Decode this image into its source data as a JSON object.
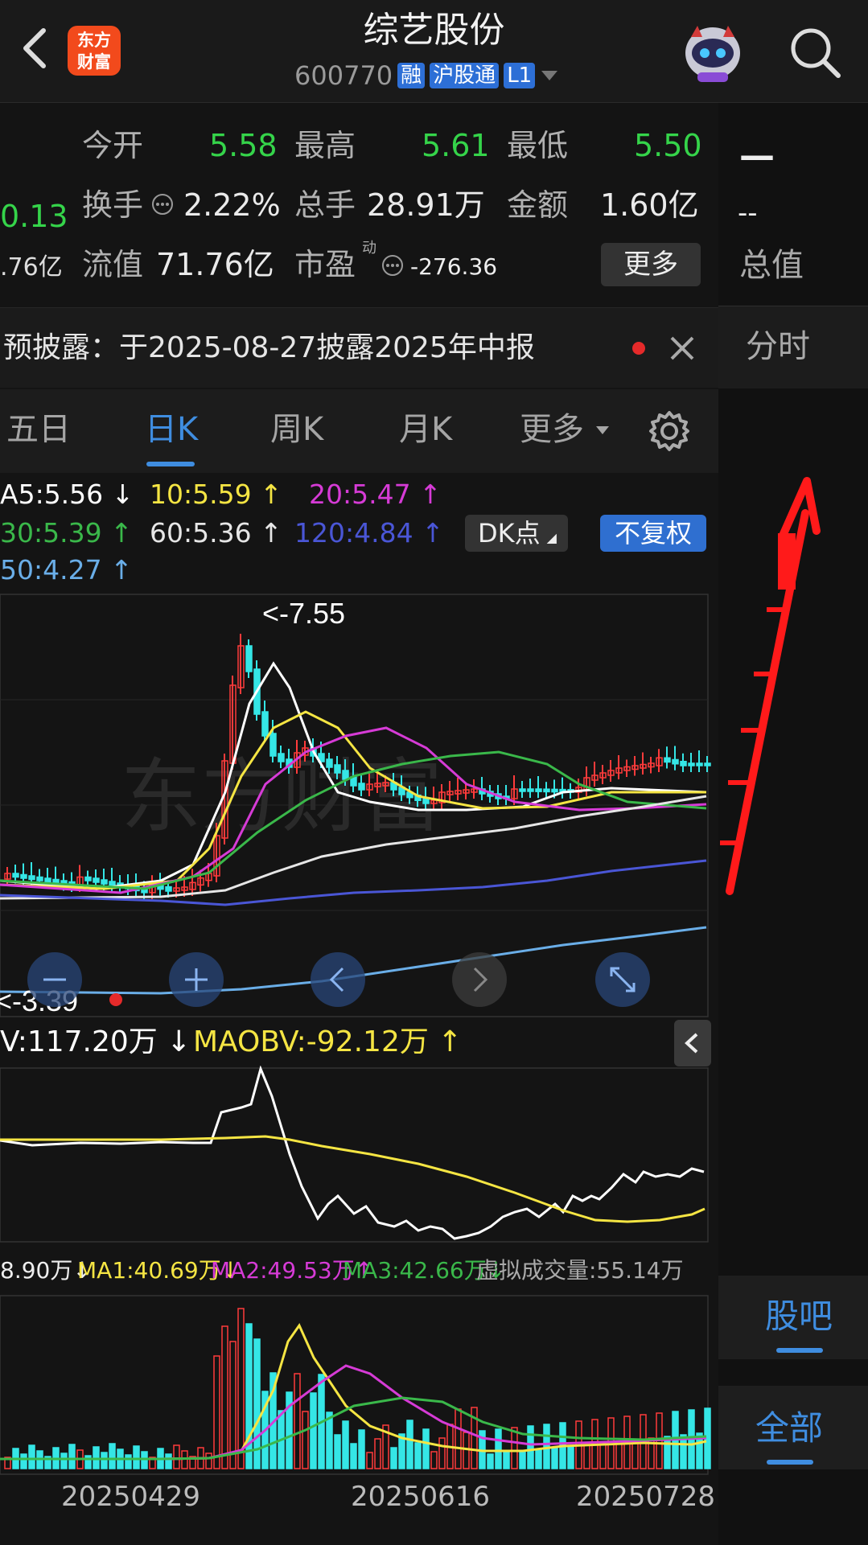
{
  "header": {
    "title": "综艺股份",
    "code": "600770",
    "tags": [
      "融",
      "沪股通",
      "L1"
    ],
    "logo_text": [
      "东方",
      "财富"
    ]
  },
  "quote": {
    "open_label": "今开",
    "open": "5.58",
    "high_label": "最高",
    "high": "5.61",
    "low_label": "最低",
    "low": "5.50",
    "turnover_label": "换手",
    "turnover": "2.22%",
    "volume_label": "总手",
    "volume": "28.91万",
    "amount_label": "金额",
    "amount": "1.60亿",
    "float_label": "流值",
    "float_value": "71.76亿",
    "pe_label": "市盈",
    "pe_sup": "动",
    "pe": "-276.36",
    "more_label": "更多",
    "left_change": "0.13",
    "left_float": ".76亿"
  },
  "right_panel": {
    "dash1": "—",
    "dash2": "--",
    "total_label": "总值",
    "fenshi_label": "分时",
    "guba_label": "股吧",
    "all_label": "全部"
  },
  "notice": {
    "text": "预披露：于2025-08-27披露2025年中报"
  },
  "tabs": [
    "五日",
    "日K",
    "周K",
    "月K",
    "更多"
  ],
  "active_tab": "日K",
  "ma_legend": {
    "ma5": "A5:5.56",
    "ma10": "10:5.59",
    "ma20": "20:5.47",
    "ma30": "30:5.39",
    "ma60": "60:5.36",
    "ma120": "120:4.84",
    "ma250": "50:4.27",
    "dk_label": "DK点",
    "fuquan_label": "不复权",
    "colors": {
      "ma5": "#ffffff",
      "ma10": "#f5e543",
      "ma20": "#d63bd6",
      "ma30": "#3ab84a",
      "ma60": "#e6e6e6",
      "ma120": "#4a56d6",
      "ma250": "#6aaee8"
    }
  },
  "price_chart": {
    "high_marker": "<-7.55",
    "low_marker": "<-3.39",
    "watermark": "东方财富"
  },
  "obv": {
    "obv_label": "V:117.20万",
    "maobv_label": "MAOBV:-92.12万"
  },
  "volume": {
    "vol_label": "8.90万",
    "ma1": "MA1:40.69万",
    "ma2": "MA2:49.53万",
    "ma3": "MA3:42.66万",
    "virtual": "虚拟成交量:55.14万",
    "dates": [
      "20250429",
      "20250616",
      "20250728"
    ]
  },
  "chart_data": {
    "type": "candlestick",
    "title": "",
    "price_range": [
      3.39,
      7.55
    ],
    "x_ticks": [
      "20250429",
      "20250616",
      "20250728"
    ],
    "annotations": [
      "<-7.55",
      "<-3.39"
    ],
    "moving_averages": [
      {
        "name": "MA5",
        "last": 5.56
      },
      {
        "name": "MA10",
        "last": 5.59
      },
      {
        "name": "MA20",
        "last": 5.47
      },
      {
        "name": "MA30",
        "last": 5.39
      },
      {
        "name": "MA60",
        "last": 5.36
      },
      {
        "name": "MA120",
        "last": 4.84
      },
      {
        "name": "MA250",
        "last": 4.27
      }
    ]
  }
}
